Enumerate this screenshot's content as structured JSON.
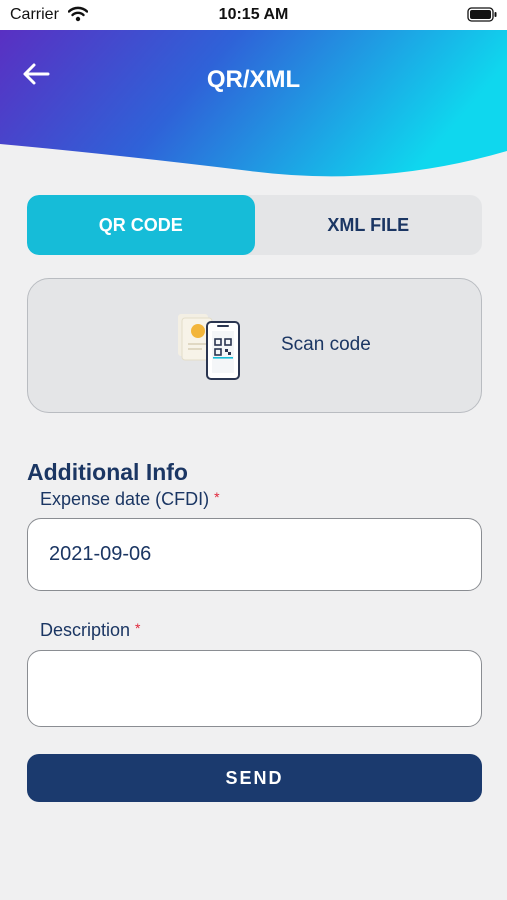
{
  "status_bar": {
    "carrier": "Carrier",
    "time": "10:15 AM"
  },
  "header": {
    "title": "QR/XML",
    "back_icon": "arrow-left-icon",
    "gradient": [
      "#5a2fc2",
      "#2f62d8",
      "#0fd7ee"
    ]
  },
  "tabs": [
    {
      "label": "QR CODE",
      "active": true
    },
    {
      "label": "XML FILE",
      "active": false
    }
  ],
  "scan": {
    "label": "Scan code",
    "icon": "qr-phone-icon"
  },
  "additional_info": {
    "title": "Additional Info",
    "expense_date": {
      "label": "Expense date (CFDI)",
      "required_mark": "*",
      "value": "2021-09-06"
    },
    "description": {
      "label": "Description",
      "required_mark": "*",
      "value": ""
    }
  },
  "send_label": "SEND",
  "colors": {
    "accent": "#16bcd8",
    "primary": "#1b3a6e",
    "required": "#e0263a",
    "background": "#f0f0f1"
  }
}
